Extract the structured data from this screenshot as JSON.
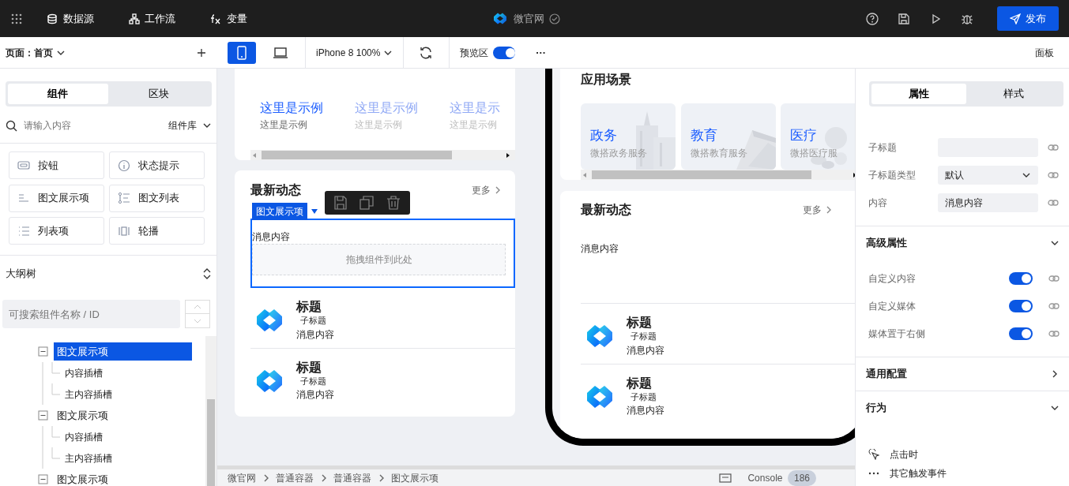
{
  "topbar": {
    "menu": [
      {
        "label": "数据源",
        "kind": "database"
      },
      {
        "label": "工作流",
        "kind": "flow"
      },
      {
        "label": "变量",
        "kind": "variable"
      }
    ],
    "app_title": "微官网",
    "publish": "发布"
  },
  "toolbar": {
    "page_label": "页面：首页",
    "devices": [
      {
        "kind": "mobile",
        "selected": true
      },
      {
        "kind": "desktop",
        "selected": false
      }
    ],
    "zoom": "iPhone 8 100%",
    "preview_label": "预览区",
    "preview_on": true,
    "more": "···",
    "panel": "面板"
  },
  "left": {
    "tabs": [
      {
        "label": "组件",
        "selected": true
      },
      {
        "label": "区块",
        "selected": false
      }
    ],
    "search": {
      "placeholder": "请输入内容"
    },
    "library": "组件库",
    "components": [
      {
        "label": "按钮",
        "kind": "button"
      },
      {
        "label": "状态提示",
        "kind": "info"
      },
      {
        "label": "图文展示项",
        "kind": "media"
      },
      {
        "label": "图文列表",
        "kind": "medialist"
      },
      {
        "label": "列表项",
        "kind": "list"
      },
      {
        "label": "轮播",
        "kind": "carousel"
      }
    ],
    "outline_title": "大纲树",
    "outline_search": {
      "placeholder": "可搜索组件名称 / ID"
    },
    "tree": [
      {
        "label": "图文展示项",
        "selected": true,
        "expanded": true,
        "children": [
          {
            "label": "内容插槽",
            "selected": false
          },
          {
            "label": "主内容插槽",
            "selected": false
          }
        ]
      },
      {
        "label": "图文展示项",
        "selected": false,
        "expanded": true,
        "children": [
          {
            "label": "内容插槽",
            "selected": false
          },
          {
            "label": "主内容插槽",
            "selected": false
          }
        ]
      },
      {
        "label": "图文展示项",
        "selected": false,
        "expanded": true
      }
    ]
  },
  "editor": {
    "examples": [
      {
        "title": "这里是示例",
        "subtitle": "这里是示例",
        "color": "#1a5cff"
      },
      {
        "title": "这里是示例",
        "subtitle": "这里是示例",
        "color": "#8fa8f5"
      },
      {
        "title": "这里是示",
        "subtitle": "这里是示例",
        "color": "#8fa8f5"
      }
    ],
    "news": {
      "title": "最新动态",
      "more": "更多",
      "tag": "图文展示项",
      "content": "消息内容",
      "drop": "拖拽组件到此处",
      "items": [
        {
          "title": "标题",
          "subtitle": "子标题",
          "content": "消息内容"
        },
        {
          "title": "标题",
          "subtitle": "子标题",
          "content": "消息内容"
        }
      ]
    }
  },
  "phone": {
    "scenes_title": "应用场景",
    "scenes": [
      {
        "title": "政务",
        "subtitle": "微搭政务服务",
        "kind": "building"
      },
      {
        "title": "教育",
        "subtitle": "微搭教育服务",
        "kind": "book"
      },
      {
        "title": "医疗",
        "subtitle": "微搭医疗服",
        "kind": "pills"
      }
    ],
    "news": {
      "title": "最新动态",
      "more": "更多",
      "content": "消息内容",
      "items": [
        {
          "title": "标题",
          "subtitle": "子标题",
          "content": "消息内容"
        },
        {
          "title": "标题",
          "subtitle": "子标题",
          "content": "消息内容"
        }
      ]
    }
  },
  "status_bar": {
    "breadcrumb": [
      "微官网",
      "普通容器",
      "普通容器",
      "图文展示项"
    ],
    "console": "Console",
    "count": "186"
  },
  "right": {
    "tabs": [
      {
        "label": "属性",
        "selected": true
      },
      {
        "label": "样式",
        "selected": false
      }
    ],
    "fields": [
      {
        "label": "子标题",
        "kind": "input"
      },
      {
        "label": "子标题类型",
        "kind": "select",
        "value": "默认"
      },
      {
        "label": "内容",
        "kind": "input",
        "value": "消息内容"
      }
    ],
    "sections": [
      {
        "title": "高级属性",
        "expanded": true,
        "toggles": [
          {
            "label": "自定义内容",
            "on": true
          },
          {
            "label": "自定义媒体",
            "on": true
          },
          {
            "label": "媒体置于右侧",
            "on": true
          }
        ]
      },
      {
        "title": "通用配置",
        "expanded": false
      },
      {
        "title": "行为",
        "expanded": true,
        "events": [
          {
            "label": "点击时",
            "kind": "click"
          },
          {
            "label": "其它触发事件",
            "kind": "more"
          }
        ]
      }
    ]
  }
}
